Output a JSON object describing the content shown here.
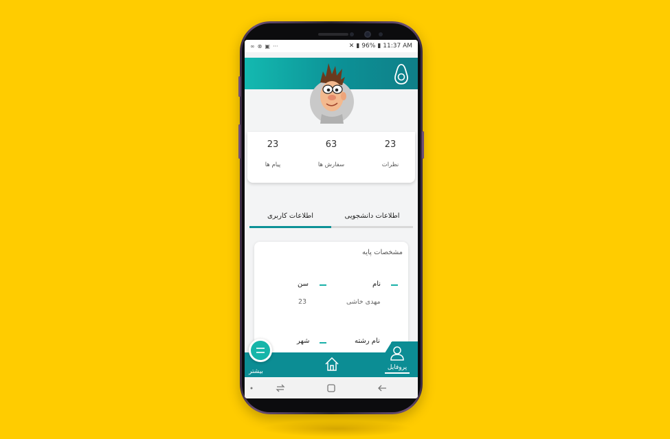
{
  "status_bar": {
    "left_icons": [
      "link-icon",
      "link-icon",
      "instagram-icon",
      "more-dots-icon"
    ],
    "battery": "96%",
    "time": "11:37 AM"
  },
  "profile": {
    "stats": [
      {
        "value": "23",
        "label": "نظرات"
      },
      {
        "value": "63",
        "label": "سفارش ها"
      },
      {
        "value": "23",
        "label": "پیام ها"
      }
    ]
  },
  "tabs": [
    {
      "label": "اطلاعات دانشجویی",
      "active": false
    },
    {
      "label": "اطلاعات کاربری",
      "active": true
    }
  ],
  "info_card": {
    "title": "مشخصات پایه",
    "fields": [
      {
        "label": "نام",
        "value": "مهدی خاشی"
      },
      {
        "label": "سن",
        "value": "23"
      },
      {
        "label": "نام رشته",
        "value": ""
      },
      {
        "label": "شهر",
        "value": ""
      }
    ]
  },
  "bottom_nav": {
    "profile_label": "پروفایل",
    "more_label": "بیشتر"
  },
  "colors": {
    "background": "#ffcc00",
    "primary": "#0c9196",
    "accent": "#16b5a9"
  }
}
